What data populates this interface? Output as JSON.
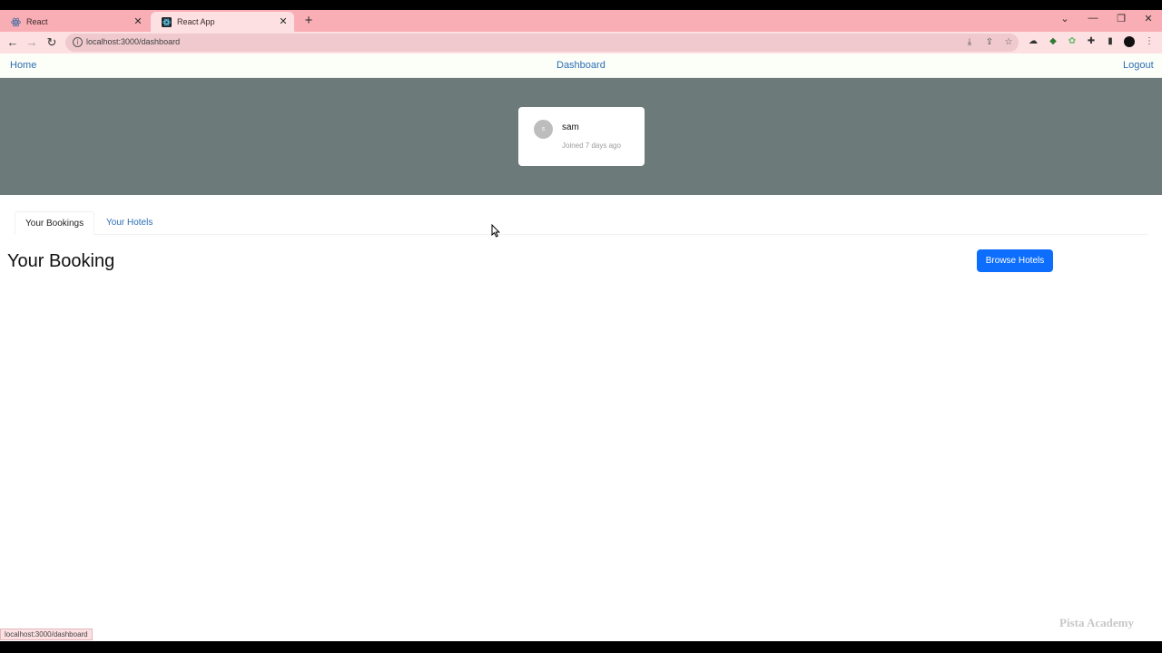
{
  "browser": {
    "tabs": [
      {
        "title": "React",
        "active": false
      },
      {
        "title": "React App",
        "active": true
      }
    ],
    "url": "localhost:3000/dashboard",
    "status_url": "localhost:3000/dashboard"
  },
  "navbar": {
    "home": "Home",
    "dashboard": "Dashboard",
    "logout": "Logout"
  },
  "profile": {
    "avatar_initial": "s",
    "name": "sam",
    "joined": "Joined 7 days ago"
  },
  "dashboard_tabs": {
    "bookings": "Your Bookings",
    "hotels": "Your Hotels"
  },
  "main": {
    "heading": "Your Booking",
    "browse_button": "Browse Hotels"
  },
  "watermark": "Pista Academy",
  "colors": {
    "tab_strip": "#f9aeb5",
    "hero": "#6d7a7a",
    "primary_button": "#0d6efd",
    "link": "#2d6fb5"
  }
}
